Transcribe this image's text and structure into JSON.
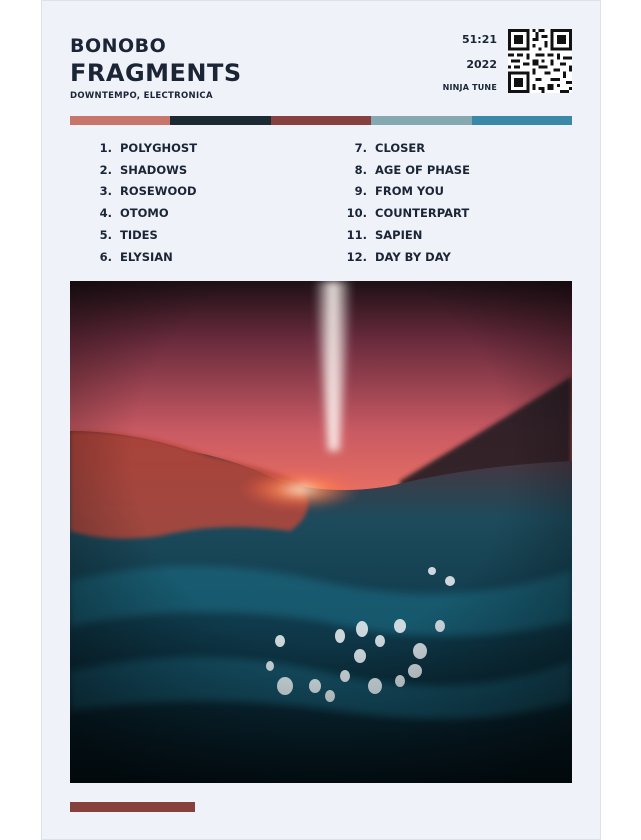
{
  "poster": {
    "artist": "BONOBO",
    "album": "FRAGMENTS",
    "genre": "DOWNTEMPO, ELECTRONICA",
    "duration": "51:21",
    "year": "2022",
    "label": "NINJA TUNE",
    "qr_icon": "qr-code-icon",
    "palette": [
      "#c8766c",
      "#1b2a33",
      "#86413f",
      "#86a8b0",
      "#3a89a8"
    ],
    "footer_color": "#86413f",
    "tracks_left": [
      {
        "num": "1.",
        "title": "POLYGHOST"
      },
      {
        "num": "2.",
        "title": "SHADOWS"
      },
      {
        "num": "3.",
        "title": "ROSEWOOD"
      },
      {
        "num": "4.",
        "title": "OTOMO"
      },
      {
        "num": "5.",
        "title": "TIDES"
      },
      {
        "num": "6.",
        "title": "ELYSIAN"
      }
    ],
    "tracks_right": [
      {
        "num": "7.",
        "title": "CLOSER"
      },
      {
        "num": "8.",
        "title": "AGE OF PHASE"
      },
      {
        "num": "9.",
        "title": "FROM YOU"
      },
      {
        "num": "10.",
        "title": "COUNTERPART"
      },
      {
        "num": "11.",
        "title": "SAPIEN"
      },
      {
        "num": "12.",
        "title": "DAY BY DAY"
      }
    ]
  }
}
